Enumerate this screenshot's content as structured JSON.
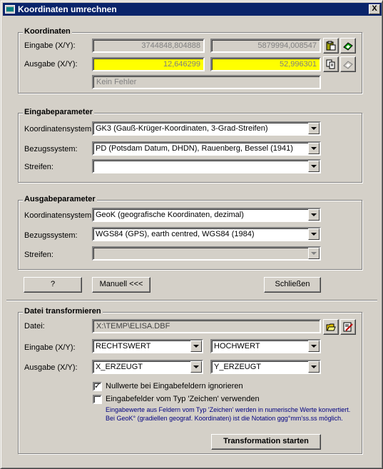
{
  "window": {
    "title": "Koordinaten umrechnen",
    "close_label": "X"
  },
  "koordinaten": {
    "group_title": "Koordinaten",
    "eingabe_label": "Eingabe (X/Y):",
    "eingabe_x": "3744848,804888",
    "eingabe_y": "5879994,008547",
    "ausgabe_label": "Ausgabe (X/Y):",
    "ausgabe_x": "12,646299",
    "ausgabe_y": "52,996301",
    "status": "Kein Fehler"
  },
  "eingabeparameter": {
    "group_title": "Eingabeparameter",
    "koordsys_label": "Koordinatensystem:",
    "koordsys_value": "GK3 (Gauß-Krüger-Koordinaten, 3-Grad-Streifen)",
    "bezug_label": "Bezugssystem:",
    "bezug_value": "PD (Potsdam Datum, DHDN), Rauenberg, Bessel (1941)",
    "streifen_label": "Streifen:",
    "streifen_value": ""
  },
  "ausgabeparameter": {
    "group_title": "Ausgabeparameter",
    "koordsys_label": "Koordinatensystem:",
    "koordsys_value": "GeoK (geografische Koordinaten, dezimal)",
    "bezug_label": "Bezugssystem:",
    "bezug_value": "WGS84 (GPS), earth centred, WGS84 (1984)",
    "streifen_label": "Streifen:",
    "streifen_value": ""
  },
  "buttons": {
    "help": "?",
    "manuell": "Manuell <<<",
    "schliessen": "Schließen",
    "transform": "Transformation starten"
  },
  "datei": {
    "group_title": "Datei transformieren",
    "datei_label": "Datei:",
    "datei_value": "X:\\TEMP\\ELISA.DBF",
    "eingabe_label": "Eingabe (X/Y):",
    "eingabe_x": "RECHTSWERT",
    "eingabe_y": "HOCHWERT",
    "ausgabe_label": "Ausgabe (X/Y):",
    "ausgabe_x": "X_ERZEUGT",
    "ausgabe_y": "Y_ERZEUGT",
    "chk_null_label": "Nullwerte bei Eingabefeldern ignorieren",
    "chk_null_checked": true,
    "chk_zeichen_label": "Eingabefelder vom Typ 'Zeichen' verwenden",
    "chk_zeichen_checked": false,
    "note_line1": "Eingabewerte aus Feldern vom Typ 'Zeichen' werden in numerische Werte konvertiert.",
    "note_line2": "Bei GeoK° (gradiellen geograf. Koordinaten) ist die Notation ggg°mm'ss.ss möglich."
  },
  "icons": [
    "app-icon",
    "paste-icon",
    "eraser-icon",
    "copy-icon",
    "eraser-disabled-icon",
    "folder-open-icon",
    "edit-icon"
  ]
}
